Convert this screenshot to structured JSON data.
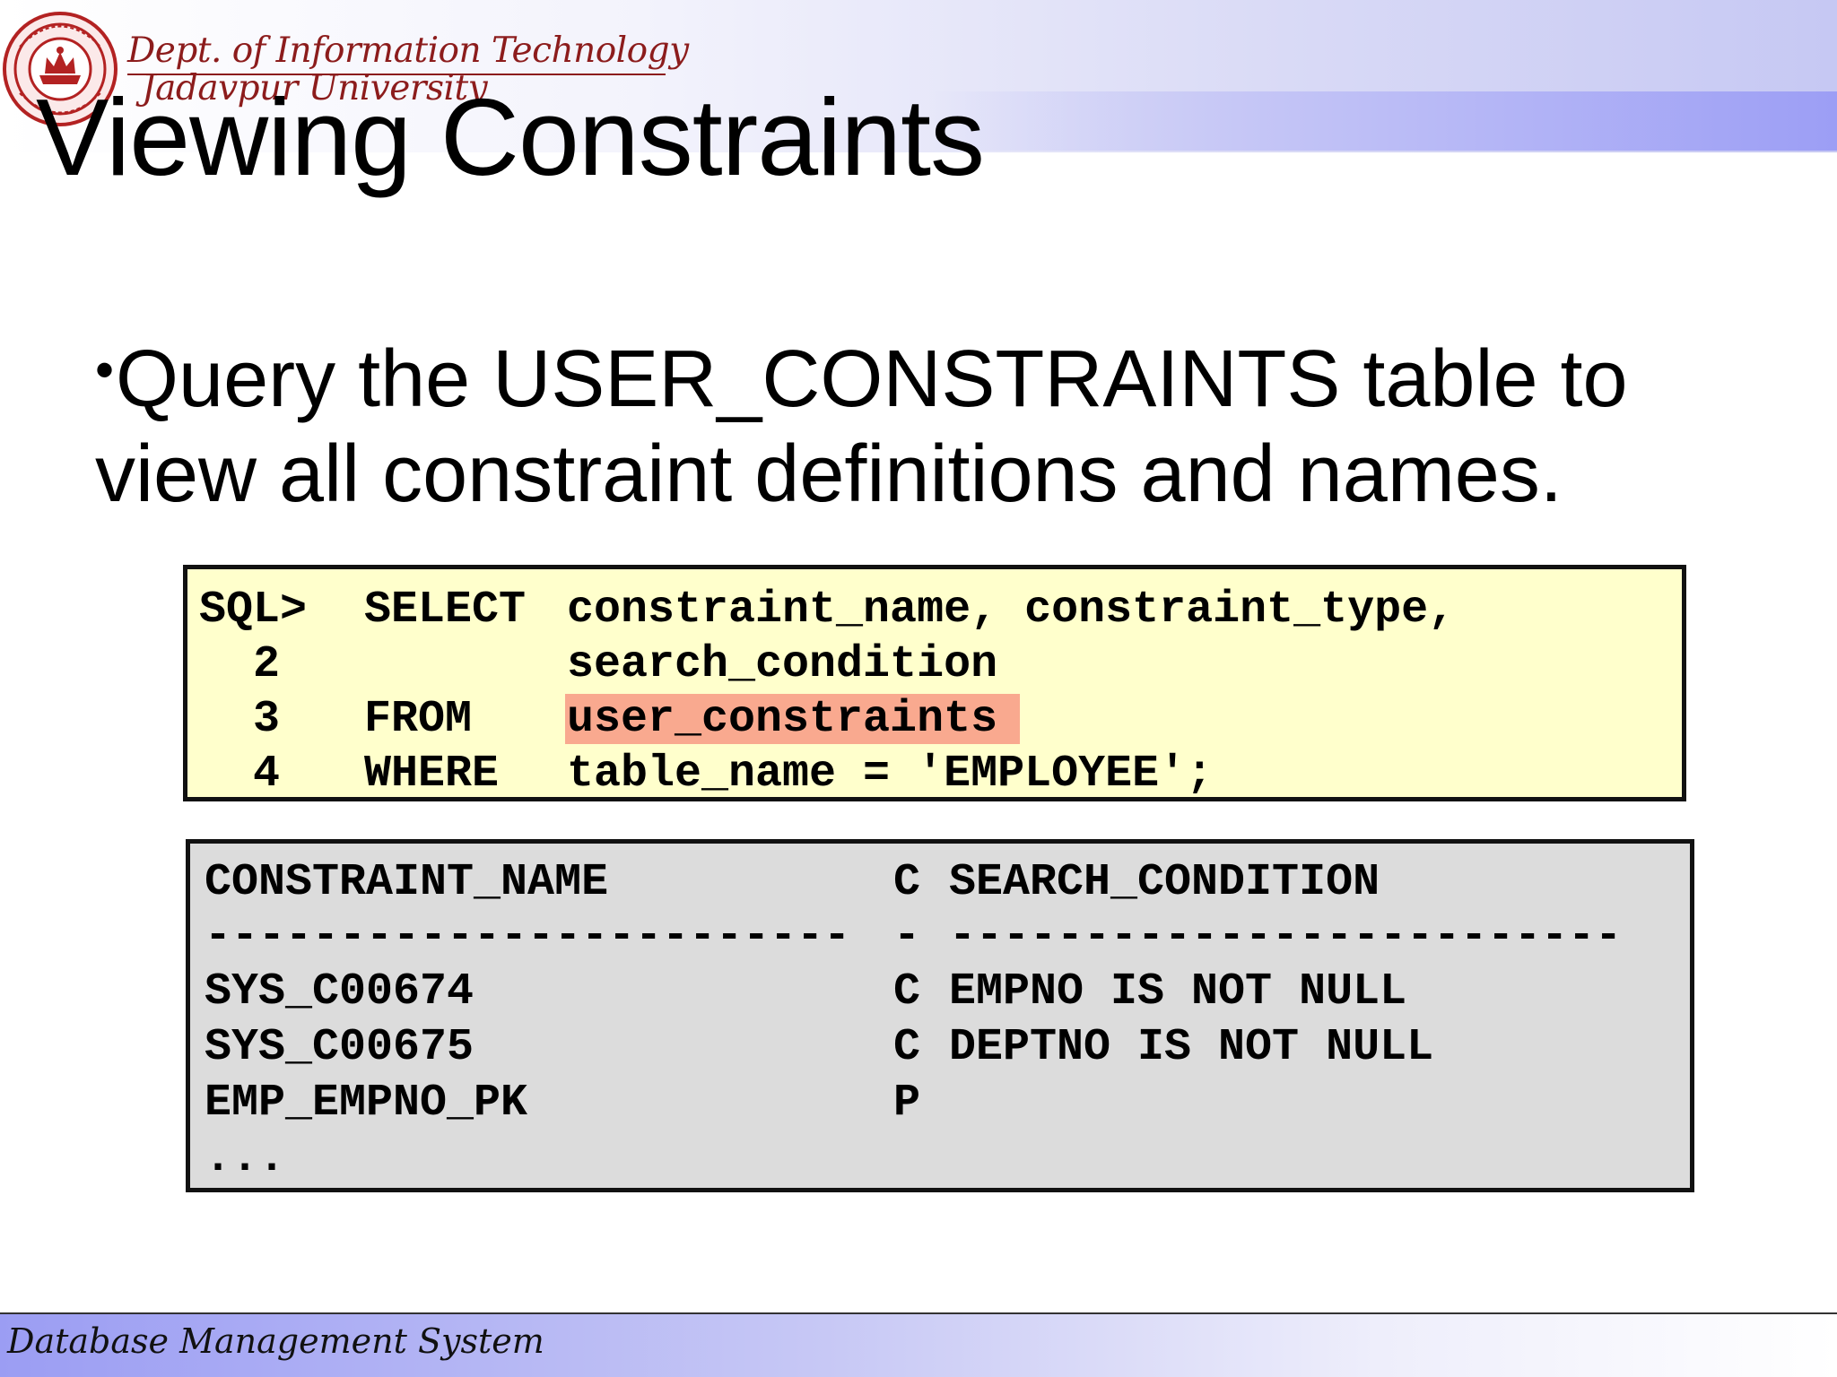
{
  "header": {
    "dept": "Dept. of Information Technology",
    "university": "Jadavpur University"
  },
  "slide": {
    "title": "Viewing Constraints",
    "bullet": "Query the USER_CONSTRAINTS table to view all constraint definitions and names."
  },
  "sql": {
    "lines": [
      {
        "num": "SQL>",
        "kw": "SELECT",
        "text": "constraint_name, constraint_type,"
      },
      {
        "num": "2",
        "kw": "",
        "text": "search_condition"
      },
      {
        "num": "3",
        "kw": "FROM",
        "text": "user_constraints"
      },
      {
        "num": "4",
        "kw": "WHERE",
        "text": "table_name = 'EMPLOYEE';"
      }
    ]
  },
  "output": {
    "headers": [
      "CONSTRAINT_NAME",
      "C",
      "SEARCH_CONDITION"
    ],
    "dividers": [
      "------------------------",
      "-",
      "-------------------------"
    ],
    "rows": [
      [
        "SYS_C00674",
        "C",
        "EMPNO IS NOT NULL"
      ],
      [
        "SYS_C00675",
        "C",
        "DEPTNO IS NOT NULL"
      ],
      [
        "EMP_EMPNO_PK",
        "P",
        ""
      ]
    ],
    "ellipsis": "..."
  },
  "footer": {
    "text": "Database Management System"
  }
}
